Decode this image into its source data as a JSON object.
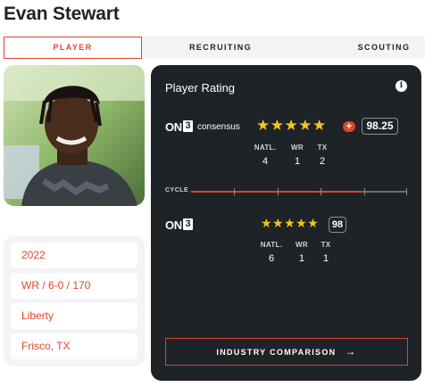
{
  "player": {
    "name": "Evan Stewart"
  },
  "tabs": [
    {
      "label": "PLAYER",
      "active": true
    },
    {
      "label": "RECRUITING",
      "active": false
    },
    {
      "label": "SCOUTING",
      "active": false
    }
  ],
  "info": {
    "class_year": "2022",
    "position_size": "WR / 6-0 / 170",
    "school": "Liberty",
    "hometown": "Frisco, TX"
  },
  "rating_panel": {
    "title": "Player Rating",
    "consensus": {
      "brand_text": "ON",
      "brand_num": "3",
      "label": "consensus",
      "stars": 5,
      "stars_glyphs": "★★★★★",
      "plus": "+",
      "score": "98.25",
      "ranks": [
        {
          "label": "NATL.",
          "value": "4"
        },
        {
          "label": "WR",
          "value": "1"
        },
        {
          "label": "TX",
          "value": "2"
        }
      ]
    },
    "cycle": {
      "label": "CYCLE",
      "progress": 0.8
    },
    "on3": {
      "brand_text": "ON",
      "brand_num": "3",
      "stars": 5,
      "stars_glyphs": "★★★★★",
      "score": "98",
      "ranks": [
        {
          "label": "NATL.",
          "value": "6"
        },
        {
          "label": "WR",
          "value": "1"
        },
        {
          "label": "TX",
          "value": "1"
        }
      ]
    },
    "comparison_button": "INDUSTRY COMPARISON",
    "comparison_arrow": "→",
    "info_icon": "i"
  },
  "colors": {
    "accent": "#e0442a",
    "panel_bg": "#1e2328",
    "star": "#f5c518"
  }
}
